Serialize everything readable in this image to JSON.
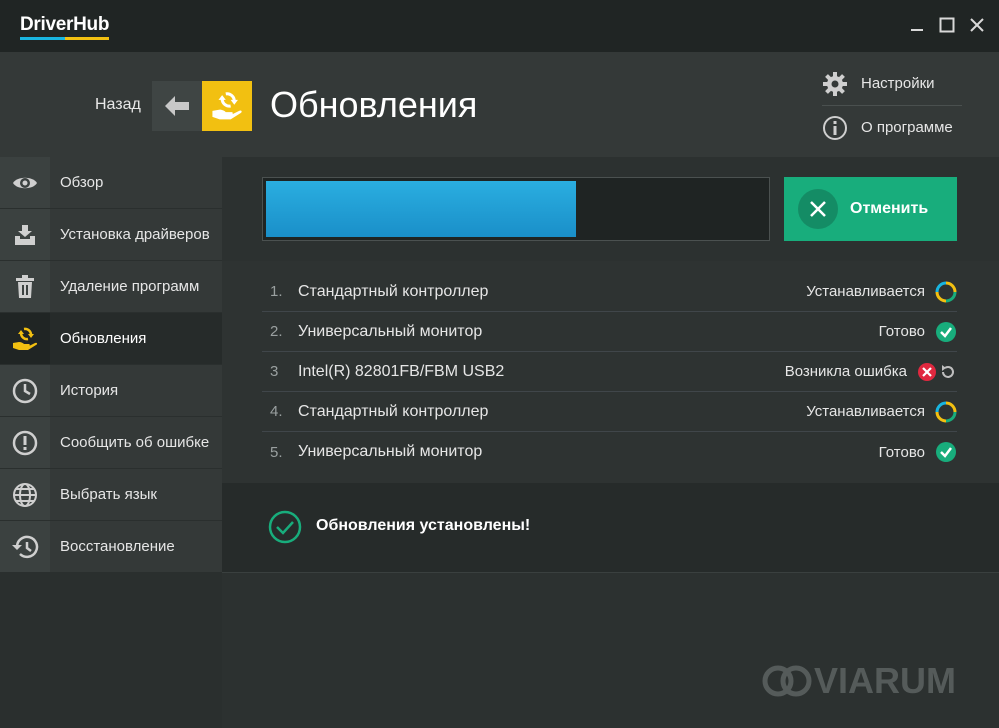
{
  "app": {
    "title": "DriverHub",
    "brand_colors": [
      "#19b5e0",
      "#f2c011"
    ]
  },
  "window_controls": {
    "minimize": "minimize-icon",
    "maximize": "maximize-icon",
    "close": "close-icon"
  },
  "back": {
    "label": "Назад",
    "icon": "arrow-left-icon"
  },
  "header": {
    "title": "Обновления",
    "icon": "update-hand-icon",
    "links": [
      {
        "label": "Настройки",
        "icon": "gear-icon"
      },
      {
        "label": "О программе",
        "icon": "info-icon"
      }
    ]
  },
  "sidebar": {
    "items": [
      {
        "label": "Обзор",
        "icon": "eye-icon",
        "active": false
      },
      {
        "label": "Установка драйверов",
        "icon": "install-drivers-icon",
        "active": false
      },
      {
        "label": "Удаление программ",
        "icon": "trash-icon",
        "active": false
      },
      {
        "label": "Обновления",
        "icon": "update-hand-icon",
        "active": true
      },
      {
        "label": "История",
        "icon": "clock-icon",
        "active": false
      },
      {
        "label": "Сообщить об ошибке",
        "icon": "exclamation-icon",
        "active": false
      },
      {
        "label": "Выбрать язык",
        "icon": "globe-icon",
        "active": false
      },
      {
        "label": "Восстановление",
        "icon": "restore-icon",
        "active": false
      }
    ]
  },
  "progress": {
    "fraction": 0.62,
    "color": "#2aaee0"
  },
  "cancel": {
    "label": "Отменить",
    "icon": "x-icon",
    "color": "#18ad7c"
  },
  "updates": [
    {
      "num": "1.",
      "name": "Стандартный контроллер",
      "status": "Устанавливается",
      "state": "installing"
    },
    {
      "num": "2.",
      "name": "Универсальный монитор",
      "status": "Готово",
      "state": "done"
    },
    {
      "num": "3",
      "name": "Intel(R) 82801FB/FBM USB2",
      "status": "Возникла ошибка",
      "state": "error"
    },
    {
      "num": "4.",
      "name": "Стандартный контроллер",
      "status": "Устанавливается",
      "state": "installing"
    },
    {
      "num": "5.",
      "name": "Универсальный монитор",
      "status": "Готово",
      "state": "done"
    }
  ],
  "footer": {
    "message": "Обновления установлены!",
    "icon": "check-circle-icon"
  },
  "watermark": "VIARUM"
}
